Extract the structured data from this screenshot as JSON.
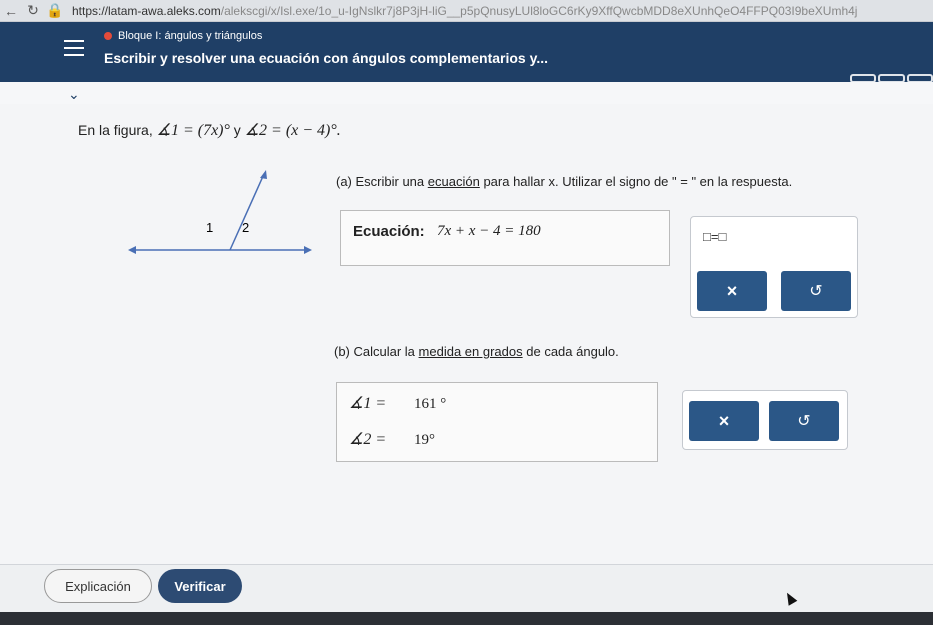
{
  "browser": {
    "url_host": "https://latam-awa.aleks.com",
    "url_path": "/alekscgi/x/Isl.exe/1o_u-IgNslkr7j8P3jH-liG__p5pQnusyLUl8loGC6rKy9XffQwcbMDD8eXUnhQeO4FFPQ03I9beXUmh4j"
  },
  "header": {
    "topic": "Bloque I: ángulos y triángulos",
    "subtitle": "Escribir y resolver una ecuación con ángulos complementarios y..."
  },
  "problem": {
    "intro_text": "En la figura,",
    "angle1_expr": "∡1 = (7x)°",
    "conj": "y",
    "angle2_expr": "∡2 = (x − 4)°.",
    "figure_labels": [
      "1",
      "2"
    ]
  },
  "part_a": {
    "prefix": "(a) Escribir una",
    "link": "ecuación",
    "suffix": "para hallar x. Utilizar el signo de \" = \" en la respuesta.",
    "eq_label": "Ecuación:",
    "eq_value": "7x + x − 4 = 180",
    "template": "□=□",
    "clear_label": "×",
    "undo_label": "↺"
  },
  "part_b": {
    "prefix": "(b) Calcular la",
    "link": "medida en grados",
    "suffix": "de cada ángulo.",
    "angle1_label": "∡1 =",
    "angle1_value": "161 °",
    "angle2_label": "∡2 =",
    "angle2_value": "19°",
    "clear_label": "×",
    "undo_label": "↺"
  },
  "footer": {
    "explain_label": "Explicación",
    "verify_label": "Verificar"
  }
}
